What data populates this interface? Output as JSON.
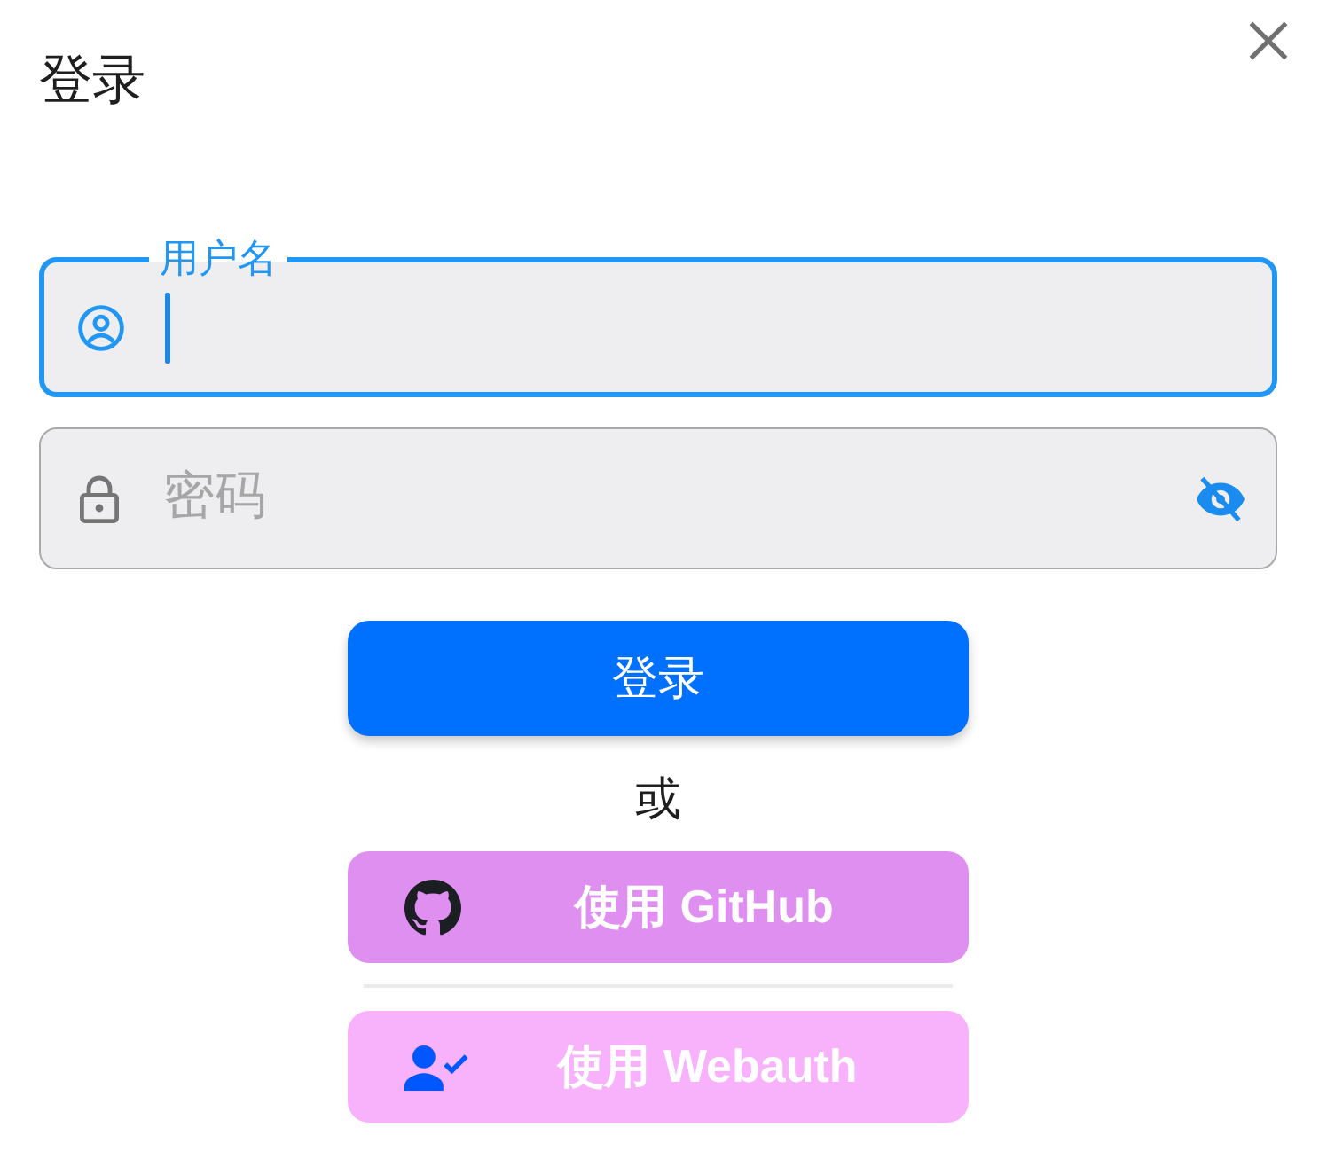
{
  "dialog": {
    "title": "登录"
  },
  "fields": [
    {
      "kind": "username",
      "label": "用户名",
      "focused": true
    },
    {
      "kind": "password",
      "placeholder": "密码",
      "focused": false,
      "revealed": false
    }
  ],
  "login_button": {
    "label": "登录"
  },
  "divider_text": "或",
  "alt_logins": [
    {
      "kind": "github",
      "label": "使用 GitHub",
      "color": "#df8ff0"
    },
    {
      "kind": "webauthn",
      "label": "使用 Webauth",
      "color": "#f7b2fb"
    }
  ]
}
